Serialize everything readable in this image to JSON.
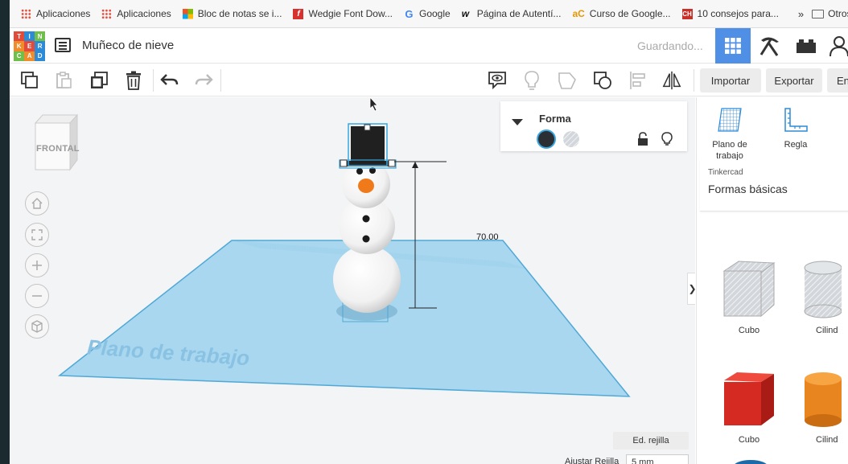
{
  "bookmarks": [
    {
      "label": "Aplicaciones",
      "icon": "apps-grid-icon"
    },
    {
      "label": "Aplicaciones",
      "icon": "apps-grid-icon"
    },
    {
      "label": "Bloc de notas se i...",
      "icon": "windows-icon"
    },
    {
      "label": "Wedgie Font Dow...",
      "icon": "flash-icon"
    },
    {
      "label": "Google",
      "icon": "google-icon"
    },
    {
      "label": "Página de Autentí...",
      "icon": "w-icon"
    },
    {
      "label": "Curso de Google...",
      "icon": "ac-icon"
    },
    {
      "label": "10 consejos para...",
      "icon": "ch-icon"
    }
  ],
  "bookmarks_more": "»",
  "bookmarks_other": "Otros",
  "logo_letters": [
    "T",
    "I",
    "N",
    "K",
    "E",
    "R",
    "C",
    "A",
    "D"
  ],
  "logo_colors": [
    "#e24b3a",
    "#2d8ad6",
    "#6fbf4a",
    "#f08c2a",
    "#e24b3a",
    "#2d8ad6",
    "#6fbf4a",
    "#f08c2a",
    "#2d8ad6"
  ],
  "header": {
    "title": "Muñeco de nieve",
    "status": "Guardando...",
    "view_active_color": "#4f8fe6"
  },
  "toolbar": {
    "import_label": "Importar",
    "export_label": "Exportar",
    "send_label": "En"
  },
  "workspace": {
    "viewcube_label": "FRONTAL",
    "workplane_label": "Plano de trabajo",
    "dimension_value": "70.00",
    "edit_grid_label": "Ed. rejilla",
    "snap_label": "Ajustar Rejilla",
    "snap_value": "5 mm"
  },
  "shape_panel": {
    "title": "Forma",
    "solid_color": "#2b2f33"
  },
  "right_panel": {
    "workplane_tool": "Plano de trabajo",
    "ruler_tool": "Regla",
    "library_source": "Tinkercad",
    "library_name": "Formas básicas",
    "items": [
      {
        "label": "Cubo",
        "style": "hole"
      },
      {
        "label": "Cilind",
        "style": "hole"
      },
      {
        "label": "Cubo",
        "style": "solid",
        "color": "#d42a22"
      },
      {
        "label": "Cilind",
        "style": "solid",
        "color": "#e8851f"
      }
    ]
  }
}
